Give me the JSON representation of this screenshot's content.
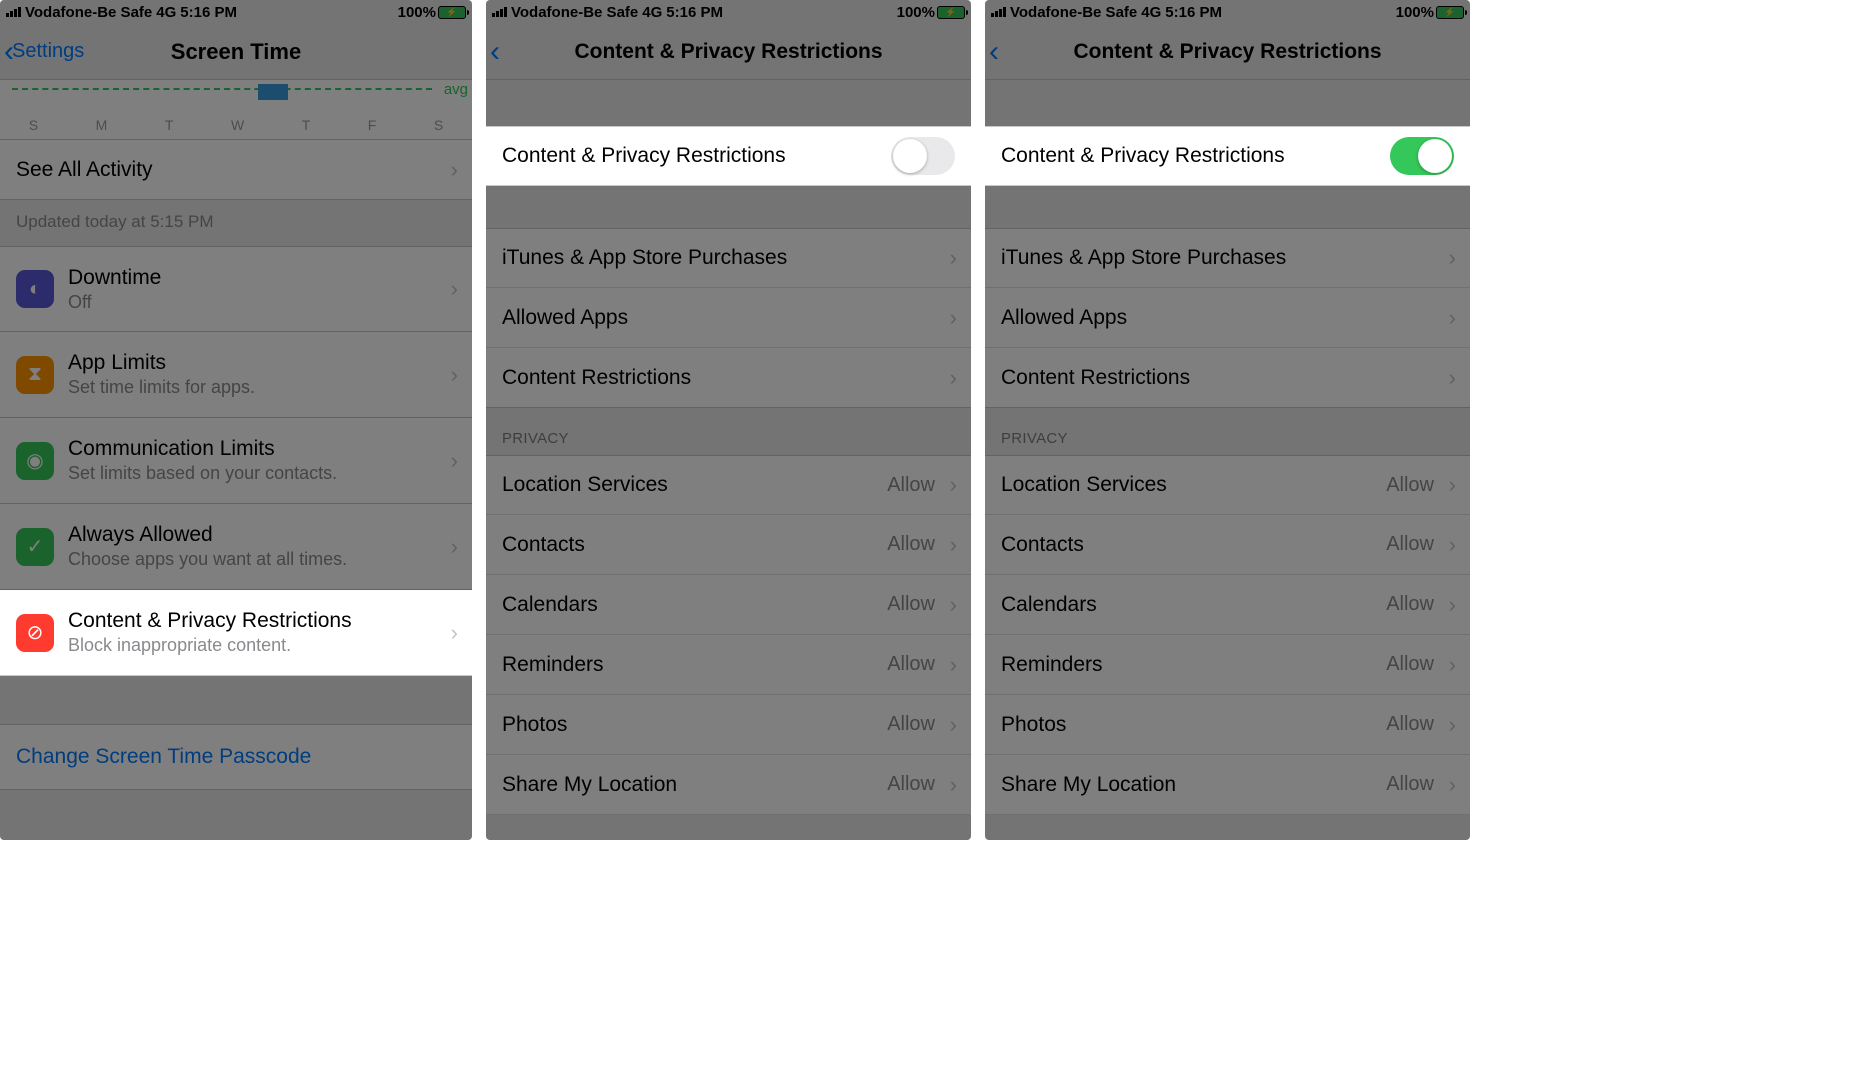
{
  "status": {
    "carrier": "Vodafone-Be Safe",
    "network": "4G",
    "time": "5:16 PM",
    "battery": "100%"
  },
  "screen1": {
    "back_label": "Settings",
    "title": "Screen Time",
    "chart_avg": "avg",
    "chart_days": [
      "S",
      "M",
      "T",
      "W",
      "T",
      "F",
      "S"
    ],
    "see_all": "See All Activity",
    "updated": "Updated today at 5:15 PM",
    "items": [
      {
        "title": "Downtime",
        "sub": "Off"
      },
      {
        "title": "App Limits",
        "sub": "Set time limits for apps."
      },
      {
        "title": "Communication Limits",
        "sub": "Set limits based on your contacts."
      },
      {
        "title": "Always Allowed",
        "sub": "Choose apps you want at all times."
      },
      {
        "title": "Content & Privacy Restrictions",
        "sub": "Block inappropriate content."
      }
    ],
    "change_passcode": "Change Screen Time Passcode"
  },
  "screen2": {
    "title": "Content & Privacy Restrictions",
    "toggle_label": "Content & Privacy Restrictions",
    "toggle_on": false,
    "group1": [
      "iTunes & App Store Purchases",
      "Allowed Apps",
      "Content Restrictions"
    ],
    "privacy_header": "PRIVACY",
    "privacy_items": [
      {
        "label": "Location Services",
        "value": "Allow"
      },
      {
        "label": "Contacts",
        "value": "Allow"
      },
      {
        "label": "Calendars",
        "value": "Allow"
      },
      {
        "label": "Reminders",
        "value": "Allow"
      },
      {
        "label": "Photos",
        "value": "Allow"
      },
      {
        "label": "Share My Location",
        "value": "Allow"
      }
    ]
  },
  "screen3": {
    "title": "Content & Privacy Restrictions",
    "toggle_label": "Content & Privacy Restrictions",
    "toggle_on": true,
    "group1": [
      "iTunes & App Store Purchases",
      "Allowed Apps",
      "Content Restrictions"
    ],
    "privacy_header": "PRIVACY",
    "privacy_items": [
      {
        "label": "Location Services",
        "value": "Allow"
      },
      {
        "label": "Contacts",
        "value": "Allow"
      },
      {
        "label": "Calendars",
        "value": "Allow"
      },
      {
        "label": "Reminders",
        "value": "Allow"
      },
      {
        "label": "Photos",
        "value": "Allow"
      },
      {
        "label": "Share My Location",
        "value": "Allow"
      }
    ]
  }
}
